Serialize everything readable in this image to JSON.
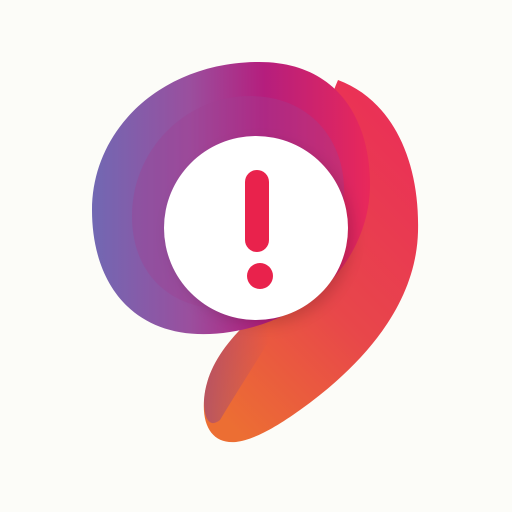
{
  "icon": {
    "name": "alert-logo-icon",
    "description_colors": {
      "background": "#fcfcf8",
      "gradient_purple": "#7168b3",
      "gradient_magenta": "#b51e7d",
      "gradient_pink": "#e9285a",
      "gradient_orange": "#ec6a34",
      "inner_circle": "#ffffff",
      "exclamation": "#e9224c"
    },
    "glyph": "!"
  }
}
